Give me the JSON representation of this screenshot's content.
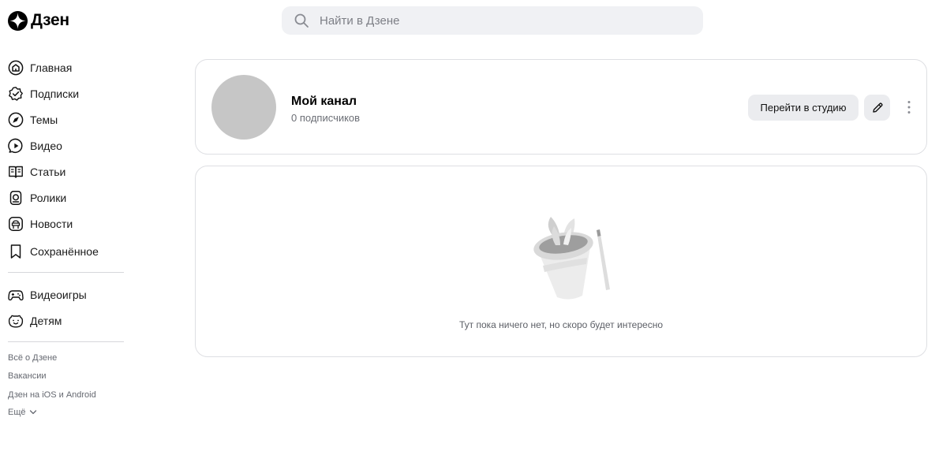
{
  "header": {
    "logo_text": "Дзен",
    "search": {
      "placeholder": "Найти в Дзене"
    }
  },
  "sidebar": {
    "items": [
      {
        "label": "Главная",
        "icon": "home-icon"
      },
      {
        "label": "Подписки",
        "icon": "subscriptions-icon"
      },
      {
        "label": "Темы",
        "icon": "compass-icon"
      },
      {
        "label": "Видео",
        "icon": "video-play-icon"
      },
      {
        "label": "Статьи",
        "icon": "book-icon"
      },
      {
        "label": "Ролики",
        "icon": "shorts-icon"
      },
      {
        "label": "Новости",
        "icon": "news-icon"
      },
      {
        "label": "Сохранённое",
        "icon": "bookmark-icon"
      }
    ],
    "extra_items": [
      {
        "label": "Видеоигры",
        "icon": "gamepad-icon"
      },
      {
        "label": "Детям",
        "icon": "bear-icon"
      }
    ],
    "footer_links": {
      "about": "Всё о Дзене",
      "jobs": "Вакансии",
      "apps": "Дзен на iOS и Android",
      "more": "Ещё"
    }
  },
  "channel": {
    "name": "Мой канал",
    "subscribers": "0 подписчиков",
    "studio_button": "Перейти в студию"
  },
  "empty_state": {
    "text": "Тут пока ничего нет, но скоро будет интересно",
    "icon": "magic-hat-icon"
  },
  "colors": {
    "search_bg": "#f0f1f4",
    "button_bg": "#ebecef",
    "avatar": "#c6c6c6",
    "card_border": "#dedfe3"
  }
}
